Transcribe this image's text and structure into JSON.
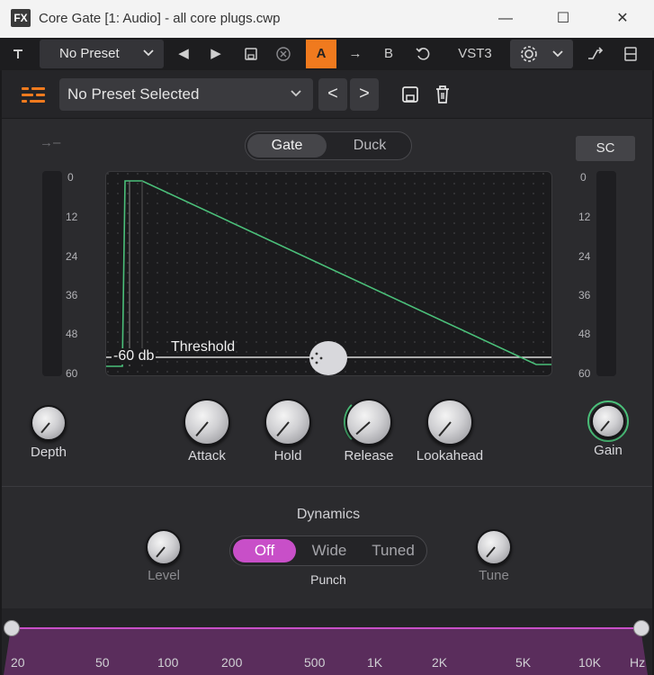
{
  "window": {
    "fx_badge": "FX",
    "title": "Core Gate [1: Audio] - all core plugs.cwp",
    "min": "—",
    "max": "☐",
    "close": "✕"
  },
  "host": {
    "preset_label": "No Preset",
    "prev": "◀",
    "next": "▶",
    "ab_a": "A",
    "ab_arrow": "→",
    "ab_b": "B",
    "format": "VST3"
  },
  "plugin": {
    "preset_selector": "No Preset Selected",
    "prev": "<",
    "next": ">",
    "mode": {
      "gate": "Gate",
      "duck": "Duck",
      "active": "Gate"
    },
    "sc_label": "SC",
    "meter_scale": [
      "0",
      "12",
      "24",
      "36",
      "48",
      "60"
    ],
    "graph": {
      "threshold_value": "-60 db",
      "threshold_label": "Threshold"
    },
    "knobs": {
      "depth": "Depth",
      "attack": "Attack",
      "hold": "Hold",
      "release": "Release",
      "lookahead": "Lookahead",
      "gain": "Gain"
    },
    "dynamics": {
      "title": "Dynamics",
      "level": "Level",
      "tune": "Tune",
      "punch_label": "Punch",
      "punch_options": [
        "Off",
        "Wide",
        "Tuned"
      ],
      "punch_selected": "Off"
    },
    "freq_labels": [
      "20",
      "50",
      "100",
      "200",
      "500",
      "1K",
      "2K",
      "5K",
      "10K",
      "Hz"
    ]
  },
  "colors": {
    "accent_orange": "#f07a1e",
    "curve_green": "#4bc07a",
    "punch_magenta": "#c84fc8",
    "band_purple": "#5a2d5c"
  }
}
